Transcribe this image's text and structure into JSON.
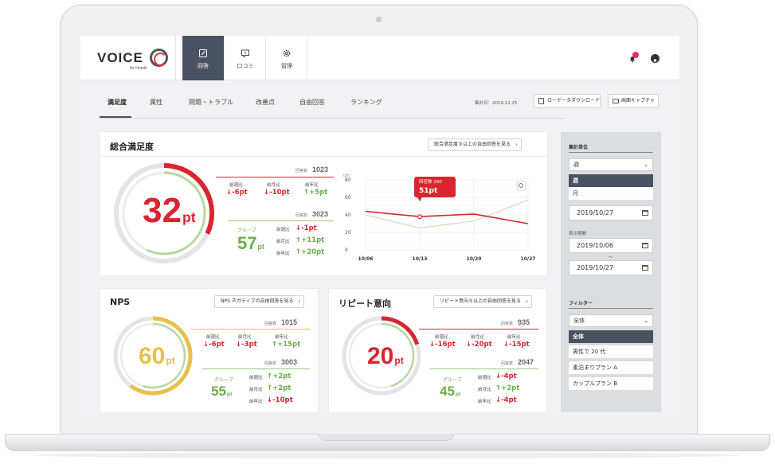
{
  "header": {
    "logo_text": "VOICE",
    "logo_sub": "for Hotels",
    "tabs": [
      {
        "label": "回答",
        "icon": "edit-icon",
        "active": true
      },
      {
        "label": "口コミ",
        "icon": "comment-icon",
        "active": false
      },
      {
        "label": "管理",
        "icon": "gear-icon",
        "active": false
      }
    ]
  },
  "subnav": {
    "tabs": [
      "満足度",
      "属性",
      "問題・トラブル",
      "改善点",
      "自由回答",
      "ランキング"
    ],
    "agg_date": "集計日：2019.11.25",
    "download_label": "ローデータダウンロード",
    "capture_label": "画面キャプチャ"
  },
  "overall": {
    "title": "総合満足度",
    "link": "総合満足度９以上の自由回答を見る",
    "score": "32",
    "unit": "pt",
    "count_label": "回答数",
    "count": "1023",
    "comparisons": [
      {
        "label": "前週比",
        "value": "-6pt",
        "dir": "down"
      },
      {
        "label": "前月比",
        "value": "-10pt",
        "dir": "down"
      },
      {
        "label": "前年比",
        "value": "+5pt",
        "dir": "up"
      }
    ],
    "group_count": "3023",
    "group_label": "グループ",
    "group_score": "57",
    "group_comparisons": [
      {
        "label": "前週比",
        "value": "-1pt",
        "dir": "down"
      },
      {
        "label": "前月比",
        "value": "+11pt",
        "dir": "up"
      },
      {
        "label": "前年比",
        "value": "+20pt",
        "dir": "up"
      }
    ],
    "gauge_pct": 32,
    "group_gauge_pct": 57
  },
  "chart_data": {
    "type": "line",
    "x": [
      "10/06",
      "10/13",
      "10/20",
      "10/27"
    ],
    "ylim": [
      0,
      80
    ],
    "yticks": [
      0,
      10,
      20,
      30,
      40,
      50,
      60,
      70,
      80
    ],
    "ylabel": "(pt)",
    "series": [
      {
        "values": [
          44,
          38,
          41,
          30
        ],
        "color": "#d9252f"
      },
      {
        "values": [
          40,
          25,
          33,
          57
        ],
        "color": "#cfe0c0"
      }
    ],
    "tooltip": {
      "label": "回答数 290",
      "value": "51pt",
      "x_index": 1
    }
  },
  "nps": {
    "title": "NPS",
    "link": "NPS ネガティブの自由回答を見る",
    "score": "60",
    "unit": "pt",
    "count": "1015",
    "comparisons": [
      {
        "label": "前週比",
        "value": "-6pt",
        "dir": "down"
      },
      {
        "label": "前月比",
        "value": "-3pt",
        "dir": "down"
      },
      {
        "label": "前年比",
        "value": "+15pt",
        "dir": "up"
      }
    ],
    "group_count": "3003",
    "group_label": "グループ",
    "group_score": "55",
    "group_comparisons": [
      {
        "label": "前週比",
        "value": "+2pt",
        "dir": "up"
      },
      {
        "label": "前月比",
        "value": "+2pt",
        "dir": "up"
      },
      {
        "label": "前年比",
        "value": "-10pt",
        "dir": "down"
      }
    ],
    "gauge_pct": 60,
    "group_gauge_pct": 55
  },
  "repeat": {
    "title": "リピート意向",
    "link": "リピート意向９以上の自由回答を見る",
    "score": "20",
    "unit": "pt",
    "count": "935",
    "comparisons": [
      {
        "label": "前週比",
        "value": "-16pt",
        "dir": "down"
      },
      {
        "label": "前月比",
        "value": "-20pt",
        "dir": "down"
      },
      {
        "label": "前年比",
        "value": "-15pt",
        "dir": "down"
      }
    ],
    "group_count": "2047",
    "group_label": "グループ",
    "group_score": "45",
    "group_comparisons": [
      {
        "label": "前週比",
        "value": "-4pt",
        "dir": "down"
      },
      {
        "label": "前月比",
        "value": "+2pt",
        "dir": "up"
      },
      {
        "label": "前年比",
        "value": "-4pt",
        "dir": "down"
      }
    ],
    "gauge_pct": 20,
    "group_gauge_pct": 45
  },
  "sidebar": {
    "unit_title": "集計単位",
    "unit_selected": "週",
    "unit_options": [
      "週",
      "月"
    ],
    "date1": "2019/10/27",
    "period_title": "表示期間",
    "date_from": "2019/10/06",
    "date_sep": "〜",
    "date_to": "2019/10/27",
    "filter_title": "フィルター",
    "filter_selected": "全体",
    "filter_options": [
      "全体",
      "男性で 20 代",
      "素泊まりプラン A",
      "カップルプラン B"
    ]
  },
  "colors": {
    "accent": "#4a5160",
    "down": "#d9252f",
    "up": "#6aae4a",
    "nps_gauge": "#e8c14a"
  }
}
